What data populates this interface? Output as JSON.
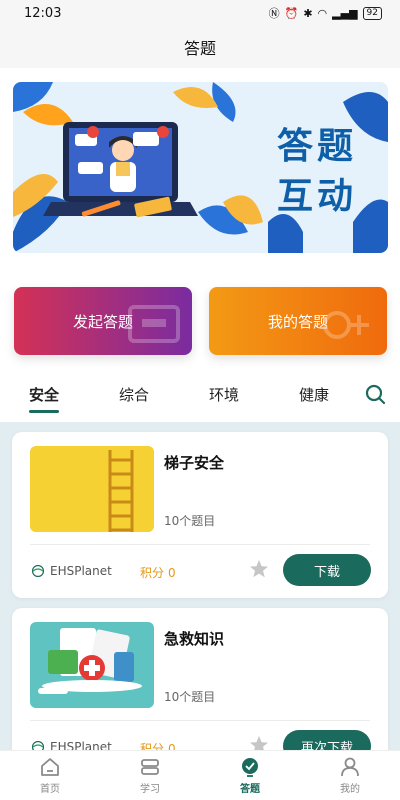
{
  "status_bar": {
    "time": "12:03",
    "signal_text": "4G",
    "battery": "92"
  },
  "header": {
    "title": "答题"
  },
  "banner": {
    "title_line1": "答题",
    "title_line2": "互动"
  },
  "actions": {
    "start_label": "发起答题",
    "mine_label": "我的答题"
  },
  "tabs": [
    {
      "label": "安全",
      "active": true
    },
    {
      "label": "综合",
      "active": false
    },
    {
      "label": "环境",
      "active": false
    },
    {
      "label": "健康",
      "active": false
    }
  ],
  "quizzes": [
    {
      "title": "梯子安全",
      "count": "10个题目",
      "brand": "EHSPlanet",
      "points_label": "积分",
      "points_value": "0",
      "button": "下载"
    },
    {
      "title": "急救知识",
      "count": "10个题目",
      "brand": "EHSPlanet",
      "points_label": "积分",
      "points_value": "0",
      "button": "再次下载"
    }
  ],
  "bottom_nav": [
    {
      "label": "首页",
      "icon": "home-icon",
      "active": false
    },
    {
      "label": "学习",
      "icon": "study-icon",
      "active": false
    },
    {
      "label": "答题",
      "icon": "quiz-icon",
      "active": true
    },
    {
      "label": "我的",
      "icon": "profile-icon",
      "active": false
    }
  ],
  "colors": {
    "accent": "#1b6a5e",
    "points": "#e29a1a",
    "start_gradient": [
      "#d43156",
      "#7a2ca0"
    ],
    "mine_gradient": [
      "#f39a15",
      "#f06a0d"
    ]
  }
}
